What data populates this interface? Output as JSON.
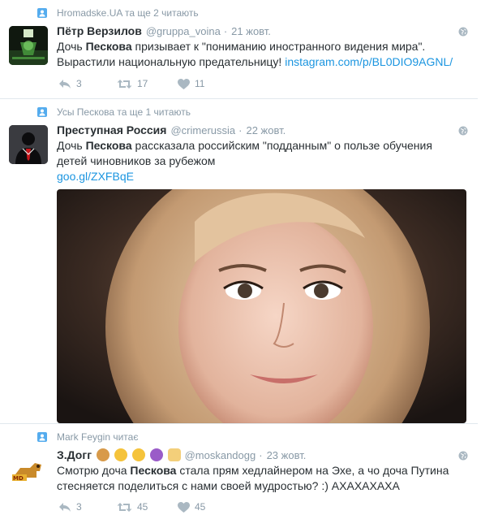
{
  "tweets": [
    {
      "context": "Hromadske.UA та ще 2 читають",
      "fullname": "Пётр Верзилов",
      "handle": "@gruppa_voina",
      "time": "21 жовт.",
      "text_parts": [
        "Дочь ",
        "Пескова",
        " призывает к \"пониманию иностранного видения мира\". Вырастили национальную предательницу! "
      ],
      "link": "instagram.com/p/BL0DIO9AGNL/",
      "reply_count": "3",
      "retweet_count": "17",
      "like_count": "11"
    },
    {
      "context": "Усы Пескова та ще 1 читають",
      "fullname": "Преступная Россия",
      "handle": "@crimerussia",
      "time": "22 жовт.",
      "text_parts": [
        "Дочь ",
        "Пескова",
        " рассказала российским \"подданным\" о пользе обучения детей чиновников за рубежом"
      ],
      "link": "goo.gl/ZXFBqE"
    },
    {
      "context": "Mark Feygin читає",
      "fullname": "З.Догг",
      "handle": "@moskandogg",
      "time": "23 жовт.",
      "text_parts": [
        "Смотрю доча ",
        "Пескова",
        " стала прям хедлайнером на Эхе, а чо доча Путина стесняется поделиться с нами своей мудростью? :) АХАХАХАХА"
      ],
      "reply_count": "3",
      "retweet_count": "45",
      "like_count": "45"
    }
  ],
  "colors": {
    "accent": "#1b95e0",
    "muted": "#8899a6",
    "text": "#292f33",
    "context_icon": "#55acee"
  },
  "icons": [
    "person-icon",
    "globe-icon",
    "reply-icon",
    "retweet-icon",
    "heart-icon"
  ]
}
